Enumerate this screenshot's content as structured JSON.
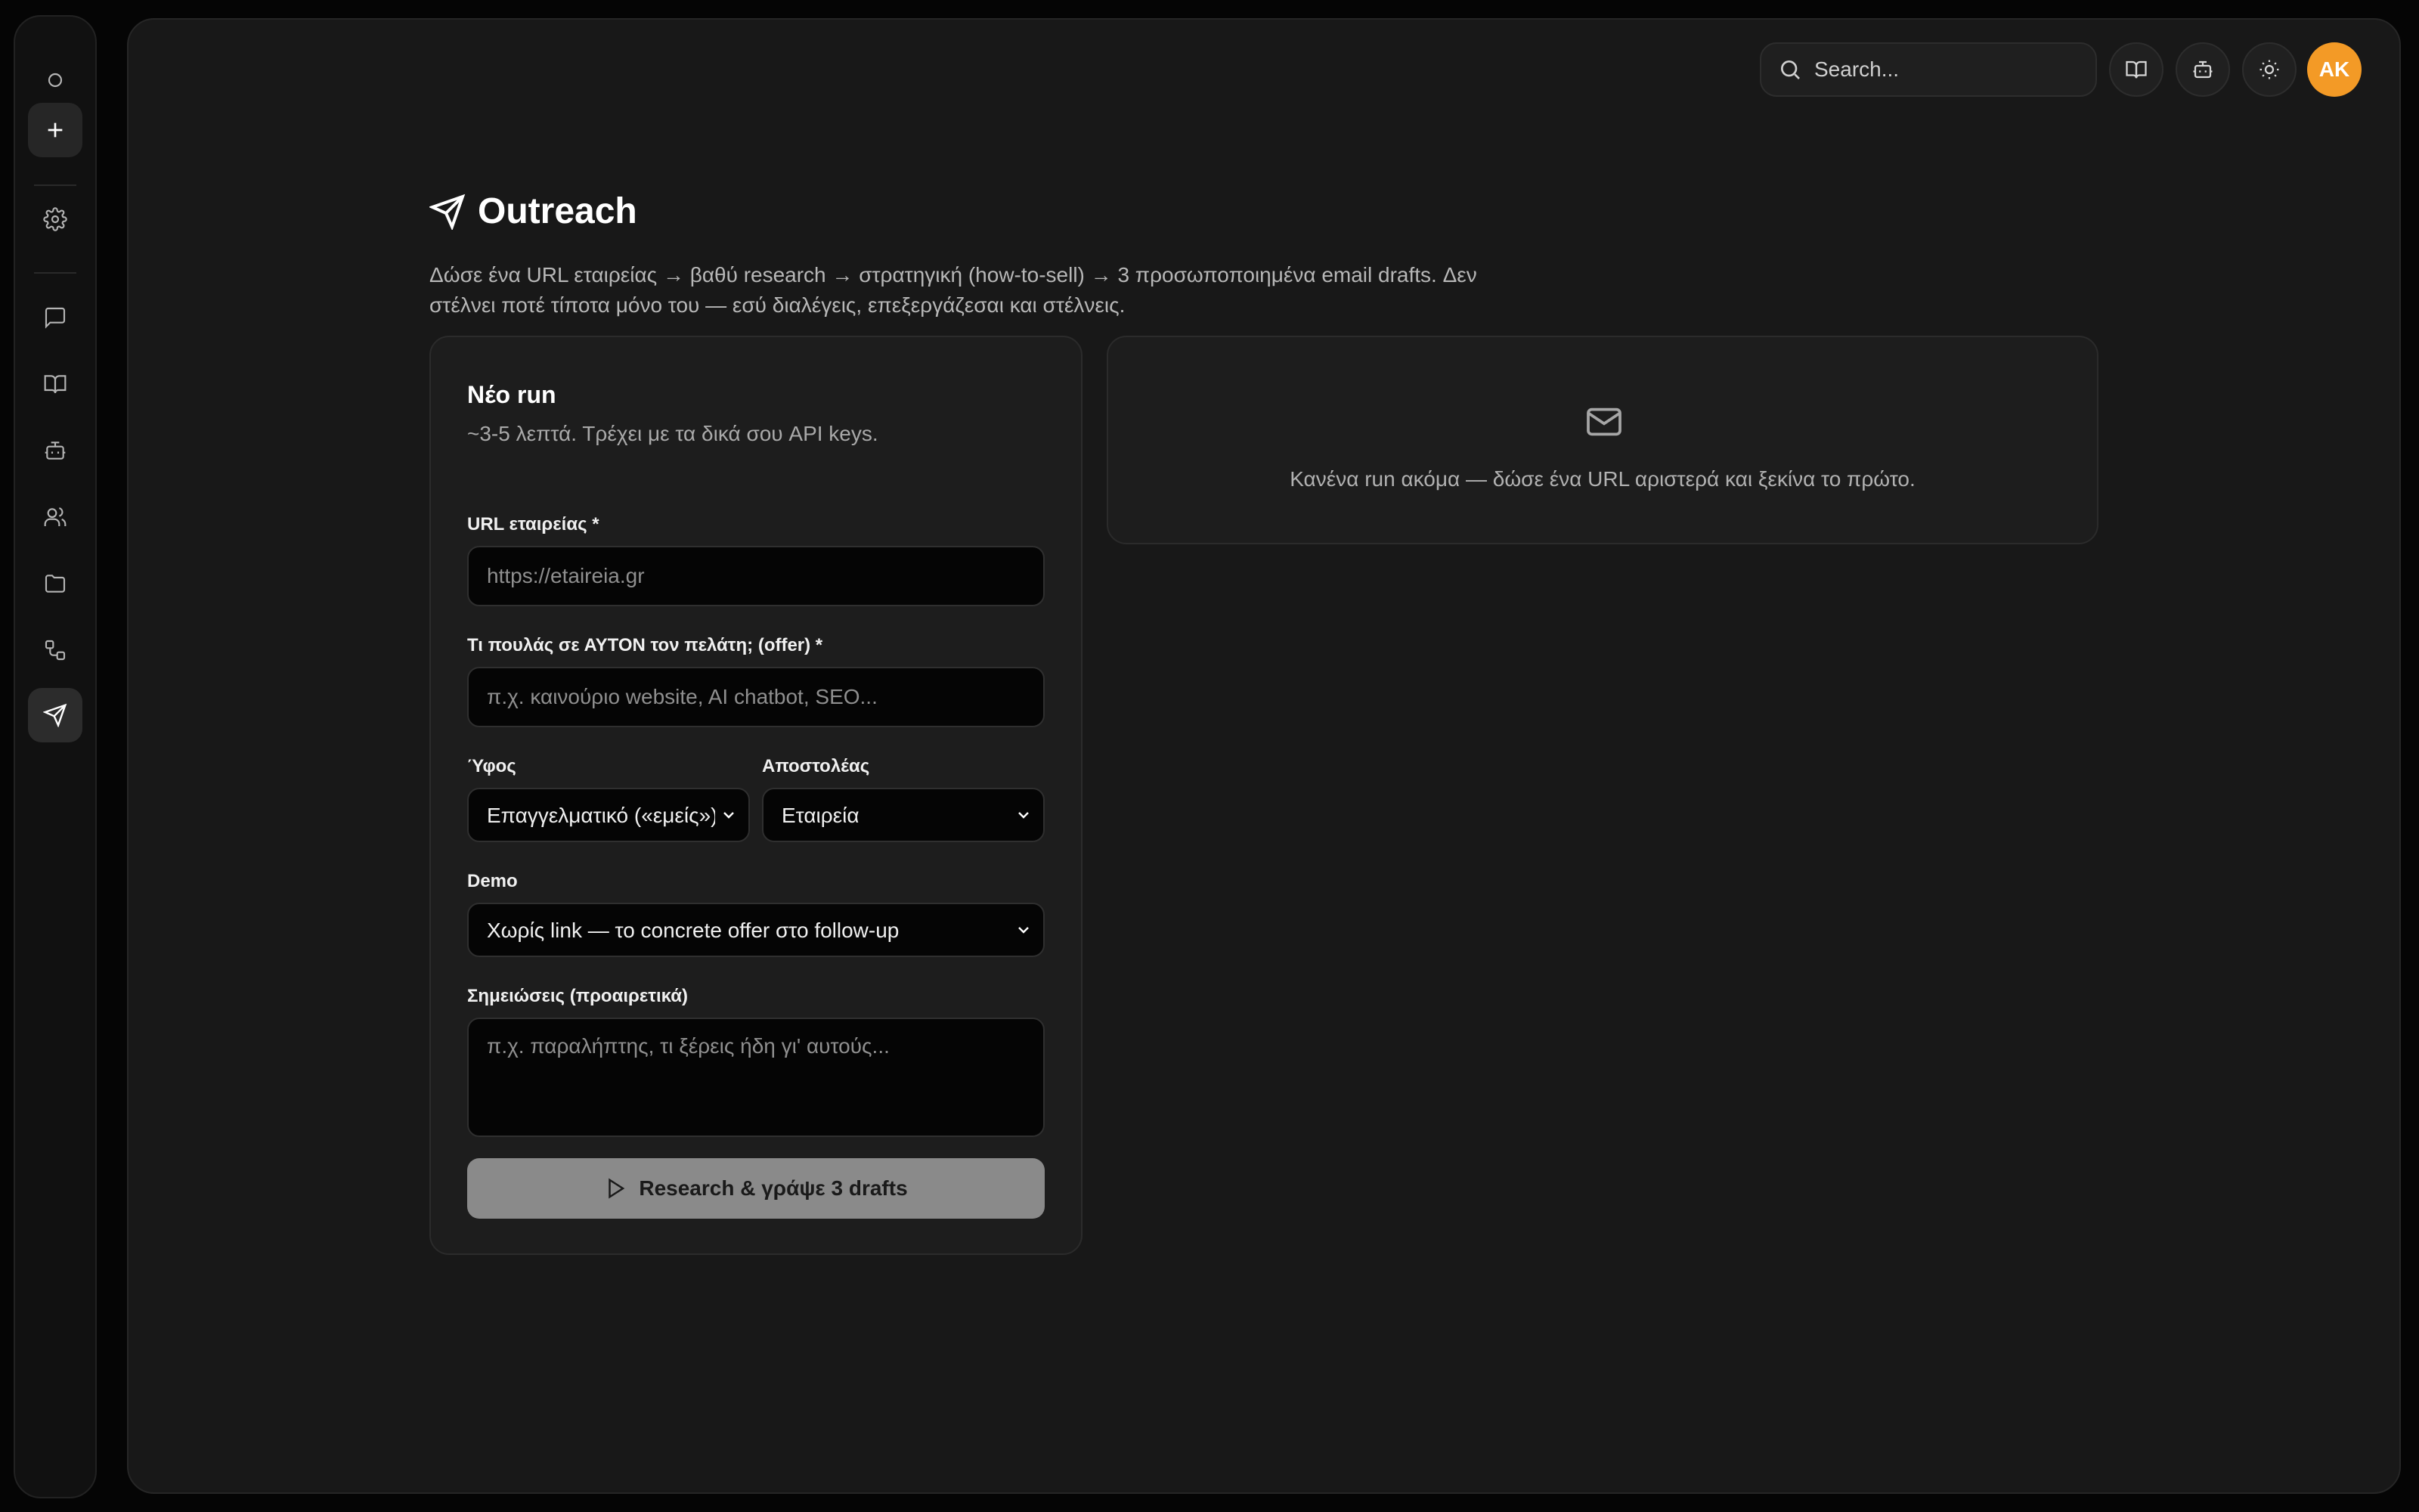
{
  "sidebar": {
    "items": [
      {
        "name": "circle",
        "icon": "circle-icon"
      },
      {
        "name": "new",
        "icon": "plus-icon"
      },
      {
        "name": "settings",
        "icon": "gear-icon"
      },
      {
        "name": "chat",
        "icon": "chat-icon"
      },
      {
        "name": "knowledge",
        "icon": "book-icon"
      },
      {
        "name": "agents",
        "icon": "bot-icon"
      },
      {
        "name": "contacts",
        "icon": "users-icon"
      },
      {
        "name": "files",
        "icon": "folder-icon"
      },
      {
        "name": "workflows",
        "icon": "workflow-icon"
      },
      {
        "name": "outreach",
        "icon": "send-icon",
        "active": true
      }
    ]
  },
  "topbar": {
    "search_placeholder": "Search...",
    "avatar_initials": "AK",
    "avatar_color": "#f39a26"
  },
  "header": {
    "title": "Outreach",
    "description": "Δώσε ένα URL εταιρείας → βαθύ research → στρατηγική (how-to-sell) → 3 προσωποποιημένα email drafts. Δεν στέλνει ποτέ τίποτα μόνο του — εσύ διαλέγεις, επεξεργάζεσαι και στέλνεις."
  },
  "form": {
    "title": "Νέο run",
    "subtitle": "~3-5 λεπτά. Τρέχει με τα δικά σου API keys.",
    "url_label": "URL εταιρείας *",
    "url_placeholder": "https://etaireia.gr",
    "offer_label": "Τι πουλάς σε ΑΥΤΟΝ τον πελάτη; (offer) *",
    "offer_placeholder": "π.χ. καινούριο website, AI chatbot, SEO...",
    "tone_label": "Ύφος",
    "tone_value": "Επαγγελματικό («εμείς»)",
    "sender_label": "Αποστολέας",
    "sender_value": "Εταιρεία",
    "demo_label": "Demo",
    "demo_value": "Χωρίς link — το concrete offer στο follow-up",
    "notes_label": "Σημειώσεις (προαιρετικά)",
    "notes_placeholder": "π.χ. παραλήπτης, τι ξέρεις ήδη γι' αυτούς...",
    "submit_label": "Research & γράψε 3 drafts"
  },
  "empty_state": {
    "icon": "mail-icon",
    "text": "Κανένα run ακόμα — δώσε ένα URL αριστερά και ξεκίνα το πρώτο."
  }
}
